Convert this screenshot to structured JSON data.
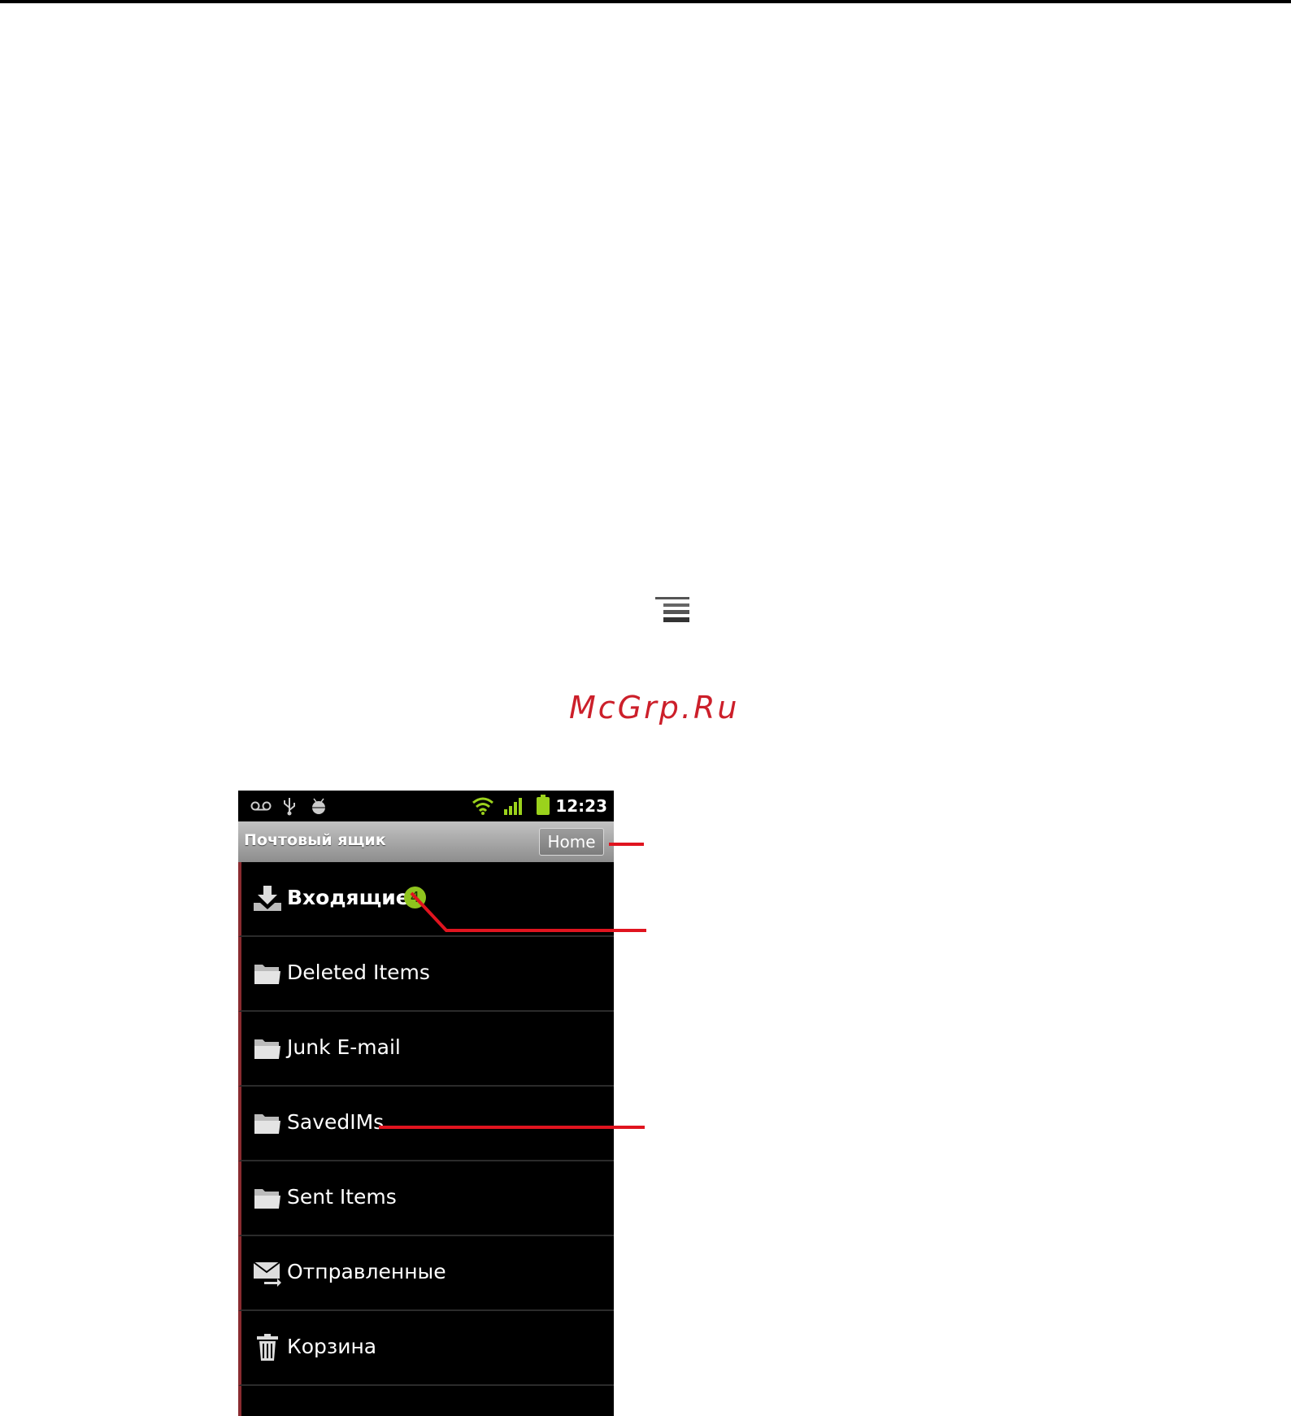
{
  "watermark": "McGrp.Ru",
  "status_bar": {
    "time": "12:23",
    "icons": [
      "voicemail-icon",
      "usb-icon",
      "android-debug-icon",
      "wifi-icon",
      "signal-icon",
      "battery-icon"
    ]
  },
  "title_bar": {
    "title": "Почтовый ящик",
    "home_button": "Home"
  },
  "folders": [
    {
      "label": "Входящие",
      "icon": "inbox-download-icon",
      "unread": "4"
    },
    {
      "label": "Deleted Items",
      "icon": "folder-icon"
    },
    {
      "label": "Junk E-mail",
      "icon": "folder-icon"
    },
    {
      "label": "SavedIMs",
      "icon": "folder-icon"
    },
    {
      "label": "Sent Items",
      "icon": "folder-icon"
    },
    {
      "label": "Отправленные",
      "icon": "outbox-envelope-icon"
    },
    {
      "label": "Корзина",
      "icon": "trash-icon"
    }
  ],
  "colors": {
    "callout": "#e0141f",
    "unread_badge": "#8fc41e",
    "title_bar": "#a8a8a8"
  }
}
